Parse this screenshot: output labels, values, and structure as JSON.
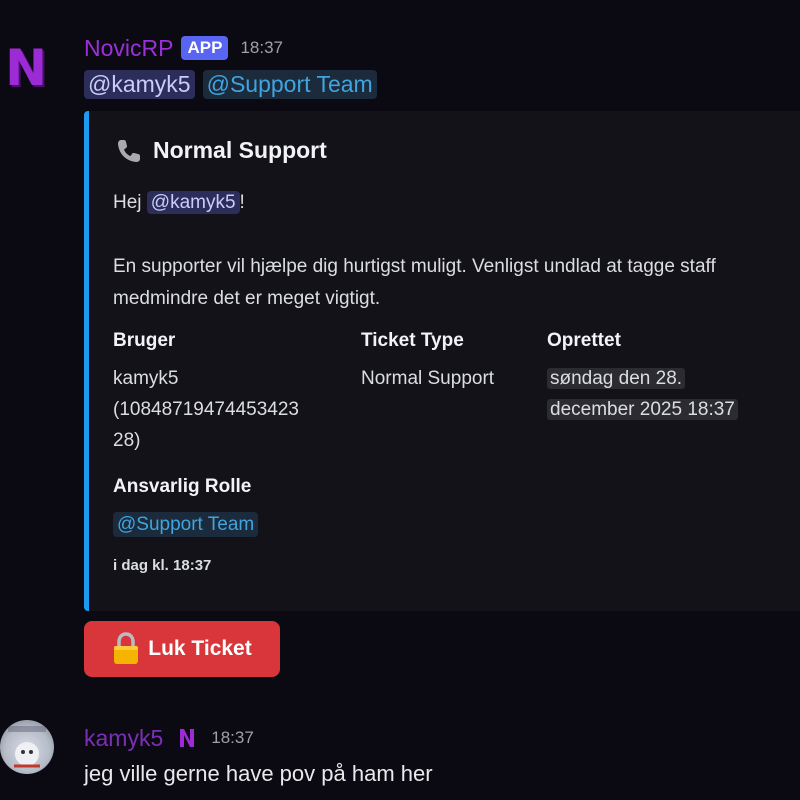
{
  "bot_message": {
    "author": "NovicRP",
    "badge": "APP",
    "time": "18:37",
    "mentions": [
      "@kamyk5",
      "@Support Team"
    ],
    "embed": {
      "title": "Normal Support",
      "desc_greeting_prefix": "Hej ",
      "desc_greeting_mention": "@kamyk5",
      "desc_greeting_suffix": "!",
      "desc_body": "En supporter vil hjælpe dig hurtigst muligt. Venligst undlad at tagge staff medmindre det er meget vigtigt.",
      "fields": {
        "user_name": "Bruger",
        "user_value_line1": "kamyk5",
        "user_value_line2": "(10848719474453423",
        "user_value_line3": "28)",
        "type_name": "Ticket Type",
        "type_value": "Normal Support",
        "created_name": "Oprettet",
        "created_value_line1": "søndag den 28.",
        "created_value_line2": "december 2025 18:37",
        "role_name": "Ansvarlig Rolle",
        "role_value": "@Support Team"
      },
      "footer": "i dag kl. 18:37",
      "accent_color": "#1d9bf0"
    },
    "button": {
      "label": "Luk Ticket",
      "icon": "lock-icon",
      "color": "#d8363b"
    }
  },
  "user_message": {
    "author": "kamyk5",
    "time": "18:37",
    "text": "jeg ville gerne have pov på ham her"
  }
}
